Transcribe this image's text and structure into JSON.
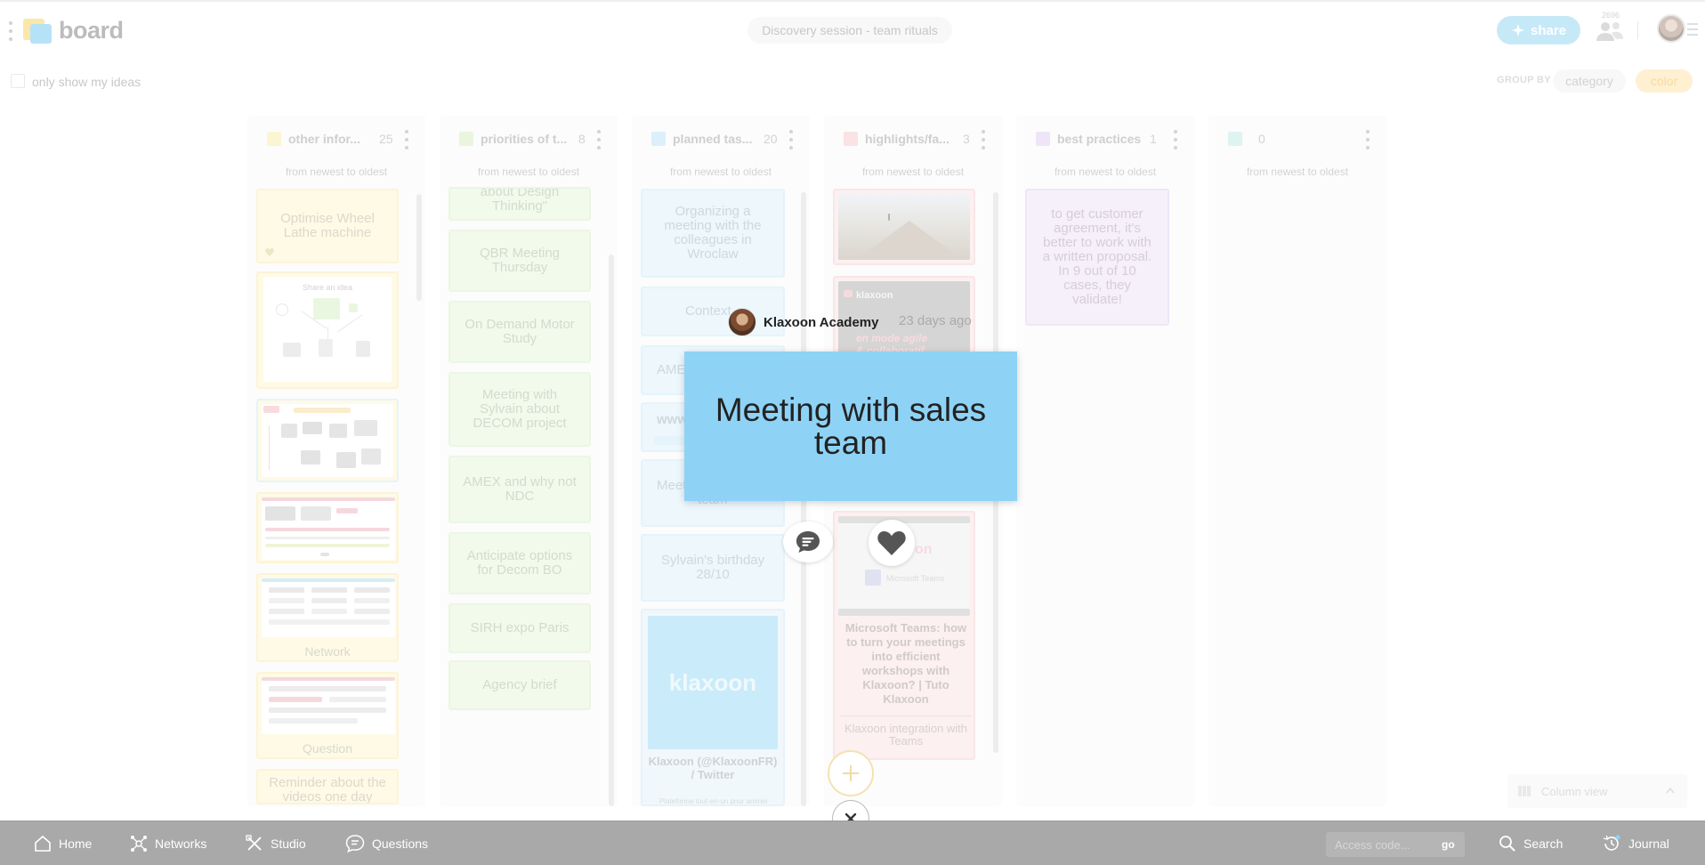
{
  "app": {
    "logo_text": "board",
    "session_title": "Discovery session - team rituals",
    "share_label": "share",
    "participants_count": "2696"
  },
  "filter": {
    "only_mine_label": "only show my ideas",
    "group_by_label": "GROUP BY",
    "group_options": [
      "category",
      "color"
    ],
    "selected": "color"
  },
  "colors": {
    "yellow": "#fbe9a5",
    "green": "#d8efc4",
    "blue": "#c5e8f9",
    "red": "#f8cdd2",
    "purple": "#e3d1f1",
    "teal": "#c9ece6",
    "idea_card": "#8ed3f6"
  },
  "columns": [
    {
      "title": "other infor...",
      "count": "25",
      "sort": "from newest to oldest",
      "color": "#fbf0b8"
    },
    {
      "title": "priorities of t...",
      "count": "8",
      "sort": "from newest to oldest",
      "color": "#ddf2cb"
    },
    {
      "title": "planned tas...",
      "count": "20",
      "sort": "from newest to oldest",
      "color": "#c8e9f9"
    },
    {
      "title": "highlights/fa...",
      "count": "3",
      "sort": "from newest to oldest",
      "color": "#f9d3d7"
    },
    {
      "title": "best practices",
      "count": "1",
      "sort": "from newest to oldest",
      "color": "#e7d8f3"
    },
    {
      "title": "",
      "count": "0",
      "sort": "from newest to oldest",
      "color": "#cdeee8"
    }
  ],
  "cards": {
    "col1": {
      "optimise": "Optimise Wheel Lathe machine",
      "share_idea": "Share an idea",
      "network": "Network",
      "question": "Question",
      "reminder": "Reminder about the videos one day"
    },
    "col2": {
      "design_thinking": "about Design Thinking\"",
      "qbr": "QBR Meeting Thursday",
      "on_demand": "On Demand Motor Study",
      "sylvain_decom": "Meeting with Sylvain about DECOM project",
      "amex": "AMEX and why not NDC",
      "anticipate": "Anticipate options for Decom BO",
      "sirh": "SIRH expo Paris",
      "agency": "Agency brief"
    },
    "col3": {
      "organizing": "Organizing a meeting with the colleagues in Wroclaw",
      "context": "Context",
      "amex_partial": "AME",
      "www_partial": "www",
      "meet_partial": "Meet",
      "team_partial": "team",
      "birthday": "Sylvain's birthday 28/10",
      "klaxoon_logo": "klaxoon",
      "klaxoon_title": "Klaxoon (@KlaxoonFR) / Twitter",
      "klaxoon_sub": "Plateforme tout-en-un pour animer facilement en équipe"
    },
    "col4": {
      "klaxoon_brand": "klaxoon",
      "agile_line1": "en mode agile",
      "agile_line2": "& collaboratif",
      "teams_brand": "Microsoft Teams",
      "teams_title": "Microsoft Teams: how to turn your meetings into efficient workshops with Klaxoon? | Tuto Klaxoon",
      "teams_sub": "Klaxoon integration with Teams"
    },
    "col5": {
      "best": "to get customer agreement, it's better to work with a written proposal. In 9 out of 10 cases, they validate!"
    }
  },
  "focused_idea": {
    "author": "Klaxoon Academy",
    "timestamp": "23 days ago",
    "text": "Meeting with sales team"
  },
  "column_view_label": "Column view",
  "bottom_nav": {
    "home": "Home",
    "networks": "Networks",
    "studio": "Studio",
    "questions": "Questions",
    "access_placeholder": "Access code...",
    "go": "go",
    "search": "Search",
    "journal": "Journal"
  }
}
